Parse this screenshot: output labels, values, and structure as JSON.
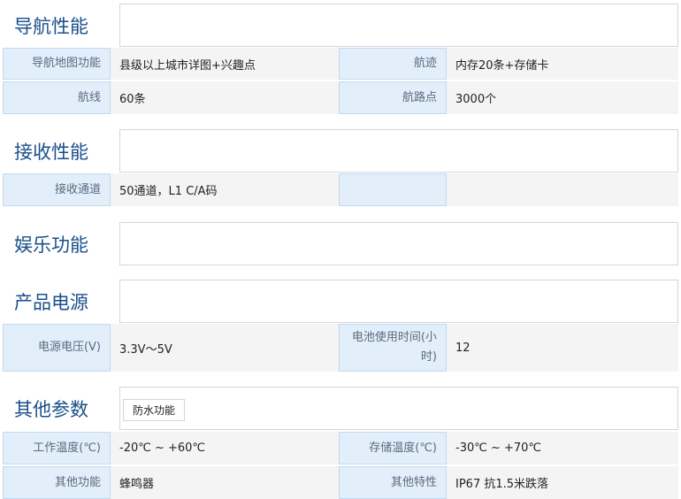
{
  "sections": {
    "nav": {
      "title": "导航性能",
      "rows": [
        {
          "l1": "导航地图功能",
          "v1": "县级以上城市详图+兴趣点",
          "l2": "航迹",
          "v2": "内存20条+存储卡"
        },
        {
          "l1": "航线",
          "v1": "60条",
          "l2": "航路点",
          "v2": "3000个"
        }
      ]
    },
    "recv": {
      "title": "接收性能",
      "rows": [
        {
          "l1": "接收通道",
          "v1": "50通道，L1 C/A码",
          "l2": "",
          "v2": ""
        }
      ]
    },
    "ent": {
      "title": "娱乐功能"
    },
    "power": {
      "title": "产品电源",
      "rows": [
        {
          "l1": "电源电压(V)",
          "v1": "3.3V～5V",
          "l2": "电池使用时间(小时)",
          "v2": "12"
        }
      ]
    },
    "other": {
      "title": "其他参数",
      "tag": "防水功能",
      "rows": [
        {
          "l1": "工作温度(℃)",
          "v1": "-20℃ ~ +60℃",
          "l2": "存储温度(℃)",
          "v2": "-30℃ ~ +70℃"
        },
        {
          "l1": "其他功能",
          "v1": "蜂鸣器",
          "l2": "其他特性",
          "v2": "IP67 抗1.5米跌落"
        }
      ]
    }
  }
}
